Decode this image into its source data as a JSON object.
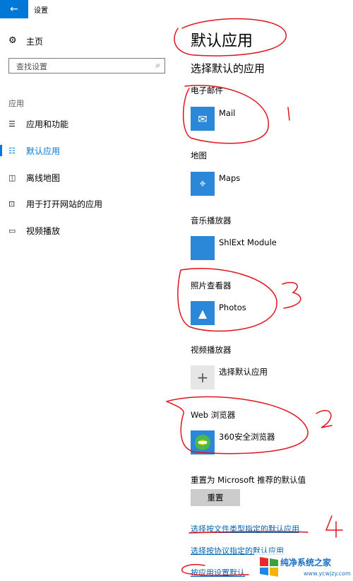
{
  "window": {
    "title": "设置",
    "back_icon": "←"
  },
  "nav": {
    "home_icon": "⚙",
    "home": "主页",
    "search_placeholder": "查找设置",
    "search_icon": "⌕",
    "section": "应用",
    "items": [
      {
        "icon": "☰",
        "label": "应用和功能"
      },
      {
        "icon": "☷",
        "label": "默认应用"
      },
      {
        "icon": "◫",
        "label": "离线地图"
      },
      {
        "icon": "⊡",
        "label": "用于打开网站的应用"
      },
      {
        "icon": "▭",
        "label": "视频播放"
      }
    ],
    "selected_index": 1
  },
  "main": {
    "title": "默认应用",
    "subtitle": "选择默认的应用",
    "categories": [
      {
        "category": "电子邮件",
        "app": "Mail",
        "icon": "✉"
      },
      {
        "category": "地图",
        "app": "Maps",
        "icon": "⌖"
      },
      {
        "category": "音乐播放器",
        "app": "ShlExt Module",
        "icon": ""
      },
      {
        "category": "照片查看器",
        "app": "Photos",
        "icon": "▲"
      },
      {
        "category": "视频播放器",
        "app": "选择默认应用",
        "icon": "+"
      },
      {
        "category": "Web 浏览器",
        "app": "360安全浏览器",
        "icon": "e"
      }
    ],
    "reset_label": "重置为 Microsoft 推荐的默认值",
    "reset_button": "重置",
    "links": [
      "选择按文件类型指定的默认应用",
      "选择按协议指定的默认应用",
      "按应用设置默认"
    ]
  },
  "annotations": [
    "1",
    "2",
    "3",
    "4"
  ],
  "watermark": {
    "text": "纯净系统之家",
    "url": "www.ycwjzy.com"
  },
  "colors": {
    "accent": "#0078d7",
    "link": "#0063b1",
    "annotation": "#e0141e"
  }
}
